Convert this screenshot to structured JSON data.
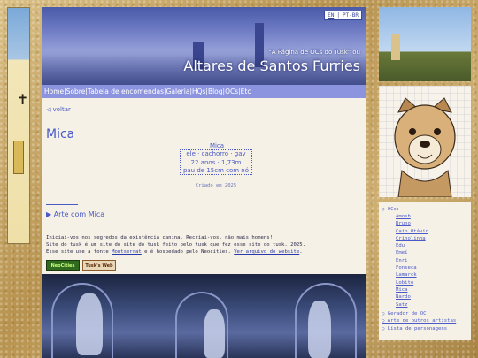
{
  "language": {
    "en": "EN",
    "separator": "|",
    "pt": "PT-BR"
  },
  "site": {
    "quote": "\"A Página de OCs do Tusk\" ou",
    "title": "Altares de Santos Furries"
  },
  "nav": {
    "items": [
      "Home",
      "Sobre",
      "Tabela de encomendas",
      "Galeria",
      "HQs",
      "Blog",
      "OCs",
      "Etc"
    ],
    "separator": "|"
  },
  "page": {
    "back": "◁ voltar",
    "character_name": "Mica",
    "info": {
      "label": "Mica",
      "line1": [
        "ele",
        "cachorro",
        "gay"
      ],
      "line2": [
        "22 anos",
        "1,73m"
      ],
      "line3": "pau de 15cm com nó",
      "dot": "·"
    },
    "created": "Criado em 2025",
    "art_toggle": "▶ Arte com Mica"
  },
  "footer": {
    "line1": "Iniciai-vos nos segredos da existência canina. Recriai-vos, não mais homens!",
    "line2": "Site do tusk é um site do site do tusk feito pelo tusk que fez esse site do tusk. 2025.",
    "line3_prefix": "Esse site use a fonte ",
    "font_link": "Montserrat",
    "line3_mid": " e é hospedado pelo Neocities. ",
    "archive_link": "Ver arquivo do website",
    "line3_suffix": ".",
    "badge1": "NeoCities",
    "badge2": "Tusk's Web"
  },
  "sidebar": {
    "tree_label": "○ OCs:",
    "ocs": [
      "Amosh",
      "Bruno",
      "Caio Otávio",
      "Crinolinha",
      "Edu",
      "Emeí",
      "Enri",
      "Fonseca",
      "Lamarck",
      "Lobito",
      "Mica",
      "Nardo",
      "Satz"
    ],
    "links": [
      "○ Gerador de OC",
      "○ Arte de outros artistas",
      "○ Lista de personagens"
    ]
  },
  "colors": {
    "accent": "#4a5ac8",
    "nav_bg": "#8c94e0",
    "paper": "#f6f1e6"
  }
}
